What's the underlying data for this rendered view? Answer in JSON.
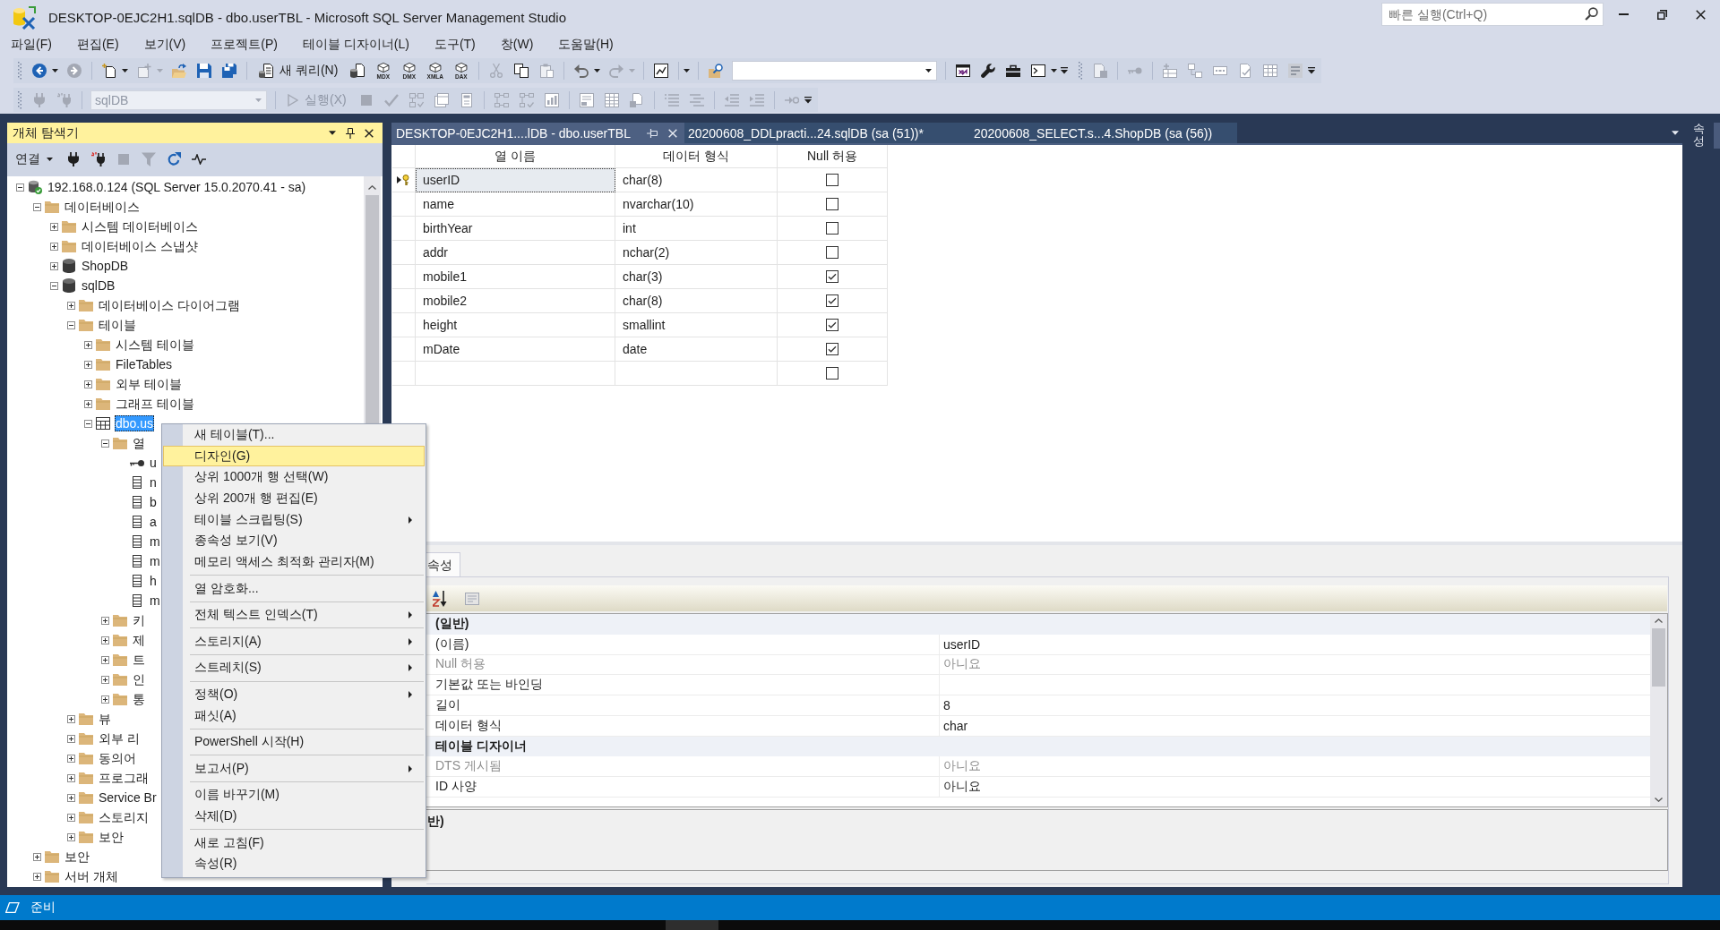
{
  "window": {
    "title": "DESKTOP-0EJC2H1.sqlDB - dbo.userTBL - Microsoft SQL Server Management Studio"
  },
  "quick_launch": {
    "placeholder": "빠른 실행(Ctrl+Q)"
  },
  "menu_bar": [
    "파일(F)",
    "편집(E)",
    "보기(V)",
    "프로젝트(P)",
    "테이블 디자이너(L)",
    "도구(T)",
    "창(W)",
    "도움말(H)"
  ],
  "toolbar": {
    "new_query": "새 쿼리(N)",
    "query_types": [
      "MDX",
      "DMX",
      "XMLA",
      "DAX"
    ],
    "database": {
      "value": "sqlDB",
      "disabled": true
    },
    "execute": {
      "label": "실행(X)",
      "disabled": true
    }
  },
  "object_explorer": {
    "title": "개체 탐색기",
    "connect": "연결",
    "tree": [
      {
        "label": "192.168.0.124 (SQL Server 15.0.2070.41 - sa)",
        "kind": "server",
        "expanded": true,
        "selected": false,
        "children": [
          {
            "label": "데이터베이스",
            "kind": "folder",
            "expanded": true,
            "selected": false,
            "children": [
              {
                "label": "시스템 데이터베이스",
                "kind": "folder",
                "expanded": false,
                "selected": false
              },
              {
                "label": "데이터베이스 스냅샷",
                "kind": "folder",
                "expanded": false,
                "selected": false
              },
              {
                "label": "ShopDB",
                "kind": "database",
                "expanded": false,
                "selected": false
              },
              {
                "label": "sqlDB",
                "kind": "database",
                "expanded": true,
                "selected": false,
                "children": [
                  {
                    "label": "데이터베이스 다이어그램",
                    "kind": "folder",
                    "expanded": false,
                    "selected": false
                  },
                  {
                    "label": "테이블",
                    "kind": "folder",
                    "expanded": true,
                    "selected": false,
                    "children": [
                      {
                        "label": "시스템 테이블",
                        "kind": "folder",
                        "expanded": false,
                        "selected": false
                      },
                      {
                        "label": "FileTables",
                        "kind": "folder",
                        "expanded": false,
                        "selected": false
                      },
                      {
                        "label": "외부 테이블",
                        "kind": "folder",
                        "expanded": false,
                        "selected": false
                      },
                      {
                        "label": "그래프 테이블",
                        "kind": "folder",
                        "expanded": false,
                        "selected": false
                      },
                      {
                        "label": "dbo.us",
                        "kind": "table",
                        "expanded": true,
                        "selected": true,
                        "children": [
                          {
                            "label": "열",
                            "kind": "folder",
                            "expanded": true,
                            "selected": false,
                            "children": [
                              {
                                "label": "u",
                                "kind": "key_column",
                                "selected": false
                              },
                              {
                                "label": "n",
                                "kind": "column",
                                "selected": false
                              },
                              {
                                "label": "b",
                                "kind": "column",
                                "selected": false
                              },
                              {
                                "label": "a",
                                "kind": "column",
                                "selected": false
                              },
                              {
                                "label": "m",
                                "kind": "column",
                                "selected": false
                              },
                              {
                                "label": "m",
                                "kind": "column",
                                "selected": false
                              },
                              {
                                "label": "h",
                                "kind": "column",
                                "selected": false
                              },
                              {
                                "label": "m",
                                "kind": "column",
                                "selected": false
                              }
                            ]
                          },
                          {
                            "label": "키",
                            "kind": "folder",
                            "expanded": false,
                            "selected": false
                          },
                          {
                            "label": "제",
                            "kind": "folder",
                            "expanded": false,
                            "selected": false
                          },
                          {
                            "label": "트",
                            "kind": "folder",
                            "expanded": false,
                            "selected": false
                          },
                          {
                            "label": "인",
                            "kind": "folder",
                            "expanded": false,
                            "selected": false
                          },
                          {
                            "label": "통",
                            "kind": "folder",
                            "expanded": false,
                            "selected": false
                          }
                        ]
                      }
                    ]
                  },
                  {
                    "label": "뷰",
                    "kind": "folder",
                    "expanded": false,
                    "selected": false
                  },
                  {
                    "label": "외부 리",
                    "kind": "folder",
                    "expanded": false,
                    "selected": false
                  },
                  {
                    "label": "동의어",
                    "kind": "folder",
                    "expanded": false,
                    "selected": false
                  },
                  {
                    "label": "프로그래",
                    "kind": "folder",
                    "expanded": false,
                    "selected": false
                  },
                  {
                    "label": "Service Br",
                    "kind": "folder",
                    "expanded": false,
                    "selected": false
                  },
                  {
                    "label": "스토리지",
                    "kind": "folder",
                    "expanded": false,
                    "selected": false
                  },
                  {
                    "label": "보안",
                    "kind": "folder",
                    "expanded": false,
                    "selected": false
                  }
                ]
              }
            ]
          },
          {
            "label": "보안",
            "kind": "folder",
            "expanded": false,
            "selected": false
          },
          {
            "label": "서버 개체",
            "kind": "folder",
            "expanded": false,
            "selected": false
          }
        ]
      }
    ]
  },
  "document_tabs": [
    {
      "label": "DESKTOP-0EJC2H1....lDB - dbo.userTBL",
      "selected": true
    },
    {
      "label": "20200608_DDLpracti...24.sqlDB (sa (51))*",
      "selected": false
    },
    {
      "label": "20200608_SELECT.s...4.ShopDB (sa (56))",
      "selected": false
    }
  ],
  "side_tabs": [
    "속성"
  ],
  "designer": {
    "columns": [
      "열 이름",
      "데이터 형식",
      "Null 허용"
    ],
    "rows": [
      {
        "name": "userID",
        "type": "char(8)",
        "allow_null": false,
        "selected": true,
        "primary_key": true
      },
      {
        "name": "name",
        "type": "nvarchar(10)",
        "allow_null": false,
        "selected": false,
        "primary_key": false
      },
      {
        "name": "birthYear",
        "type": "int",
        "allow_null": false,
        "selected": false,
        "primary_key": false
      },
      {
        "name": "addr",
        "type": "nchar(2)",
        "allow_null": false,
        "selected": false,
        "primary_key": false
      },
      {
        "name": "mobile1",
        "type": "char(3)",
        "allow_null": true,
        "selected": false,
        "primary_key": false
      },
      {
        "name": "mobile2",
        "type": "char(8)",
        "allow_null": true,
        "selected": false,
        "primary_key": false
      },
      {
        "name": "height",
        "type": "smallint",
        "allow_null": true,
        "selected": false,
        "primary_key": false
      },
      {
        "name": "mDate",
        "type": "date",
        "allow_null": true,
        "selected": false,
        "primary_key": false
      },
      {
        "allow_null": false,
        "selected": false,
        "primary_key": false
      }
    ]
  },
  "column_properties": {
    "tab": "속성",
    "rows": [
      {
        "kind": "category",
        "label": "(일반)"
      },
      {
        "kind": "property",
        "name": "(이름)",
        "value": "userID",
        "disabled": false
      },
      {
        "kind": "property",
        "name": "Null 허용",
        "value": "아니요",
        "disabled": true
      },
      {
        "kind": "property",
        "name": "기본값 또는 바인딩",
        "disabled": false
      },
      {
        "kind": "property",
        "name": "길이",
        "value": "8",
        "disabled": false
      },
      {
        "kind": "property",
        "name": "데이터 형식",
        "value": "char",
        "disabled": false
      },
      {
        "kind": "category",
        "label": "테이블 디자이너"
      },
      {
        "kind": "property",
        "name": "DTS 게시됨",
        "value": "아니요",
        "disabled": true
      },
      {
        "kind": "property",
        "name": "ID 사양",
        "value": "아니요",
        "disabled": false
      }
    ],
    "description": "반)"
  },
  "context_menu": {
    "items": [
      {
        "kind": "item",
        "label": "새 테이블(T)...",
        "selected": false,
        "submenu": false
      },
      {
        "kind": "item",
        "label": "디자인(G)",
        "selected": true,
        "submenu": false
      },
      {
        "kind": "item",
        "label": "상위 1000개 행 선택(W)",
        "selected": false,
        "submenu": false
      },
      {
        "kind": "item",
        "label": "상위 200개 행 편집(E)",
        "selected": false,
        "submenu": false
      },
      {
        "kind": "item",
        "label": "테이블 스크립팅(S)",
        "selected": false,
        "submenu": true
      },
      {
        "kind": "item",
        "label": "종속성 보기(V)",
        "selected": false,
        "submenu": false
      },
      {
        "kind": "item",
        "label": "메모리 액세스 최적화 관리자(M)",
        "selected": false,
        "submenu": false
      },
      {
        "kind": "separator"
      },
      {
        "kind": "item",
        "label": "열 암호화...",
        "selected": false,
        "submenu": false
      },
      {
        "kind": "separator"
      },
      {
        "kind": "item",
        "label": "전체 텍스트 인덱스(T)",
        "selected": false,
        "submenu": true
      },
      {
        "kind": "separator"
      },
      {
        "kind": "item",
        "label": "스토리지(A)",
        "selected": false,
        "submenu": true
      },
      {
        "kind": "separator"
      },
      {
        "kind": "item",
        "label": "스트레치(S)",
        "selected": false,
        "submenu": true
      },
      {
        "kind": "separator"
      },
      {
        "kind": "item",
        "label": "정책(O)",
        "selected": false,
        "submenu": true
      },
      {
        "kind": "item",
        "label": "패싯(A)",
        "selected": false,
        "submenu": false
      },
      {
        "kind": "separator"
      },
      {
        "kind": "item",
        "label": "PowerShell 시작(H)",
        "selected": false,
        "submenu": false
      },
      {
        "kind": "separator"
      },
      {
        "kind": "item",
        "label": "보고서(P)",
        "selected": false,
        "submenu": true
      },
      {
        "kind": "separator"
      },
      {
        "kind": "item",
        "label": "이름 바꾸기(M)",
        "selected": false,
        "submenu": false
      },
      {
        "kind": "item",
        "label": "삭제(D)",
        "selected": false,
        "submenu": false
      },
      {
        "kind": "separator"
      },
      {
        "kind": "item",
        "label": "새로 고침(F)",
        "selected": false,
        "submenu": false
      },
      {
        "kind": "item",
        "label": "속성(R)",
        "selected": false,
        "submenu": false
      }
    ]
  },
  "status_bar": {
    "text": "준비"
  }
}
